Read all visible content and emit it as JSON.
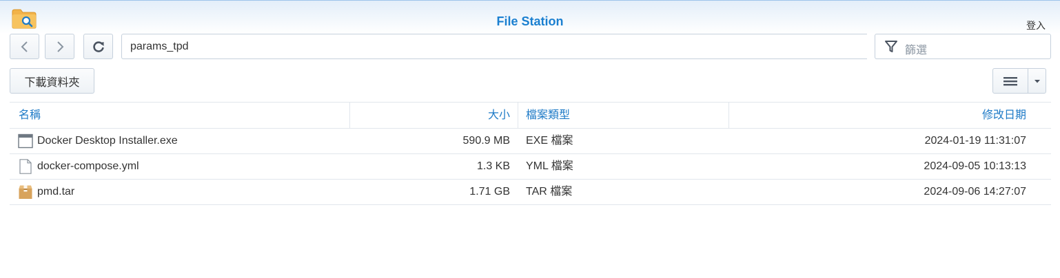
{
  "app": {
    "title": "File Station",
    "login_label": "登入",
    "logo_icon": "file-station-folder-icon"
  },
  "toolbar": {
    "back_icon": "chevron-left-icon",
    "forward_icon": "chevron-right-icon",
    "refresh_icon": "refresh-icon",
    "path": "params_tpd",
    "filter_icon": "filter-icon",
    "filter_placeholder": "篩選",
    "download_folder_label": "下載資料夾",
    "view_list_icon": "list-view-icon",
    "view_dropdown_icon": "caret-down-icon"
  },
  "columns": {
    "name": "名稱",
    "size": "大小",
    "type": "檔案類型",
    "modified": "修改日期"
  },
  "files": [
    {
      "icon": "exe-file-icon",
      "name": "Docker Desktop Installer.exe",
      "size": "590.9 MB",
      "type": "EXE 檔案",
      "modified": "2024-01-19 11:31:07"
    },
    {
      "icon": "document-file-icon",
      "name": "docker-compose.yml",
      "size": "1.3 KB",
      "type": "YML 檔案",
      "modified": "2024-09-05 10:13:13"
    },
    {
      "icon": "archive-file-icon",
      "name": "pmd.tar",
      "size": "1.71 GB",
      "type": "TAR 檔案",
      "modified": "2024-09-06 14:27:07"
    }
  ],
  "colors": {
    "accent": "#1a7fd0",
    "header_text": "#1f7bc7",
    "border": "#c5d0dc"
  }
}
